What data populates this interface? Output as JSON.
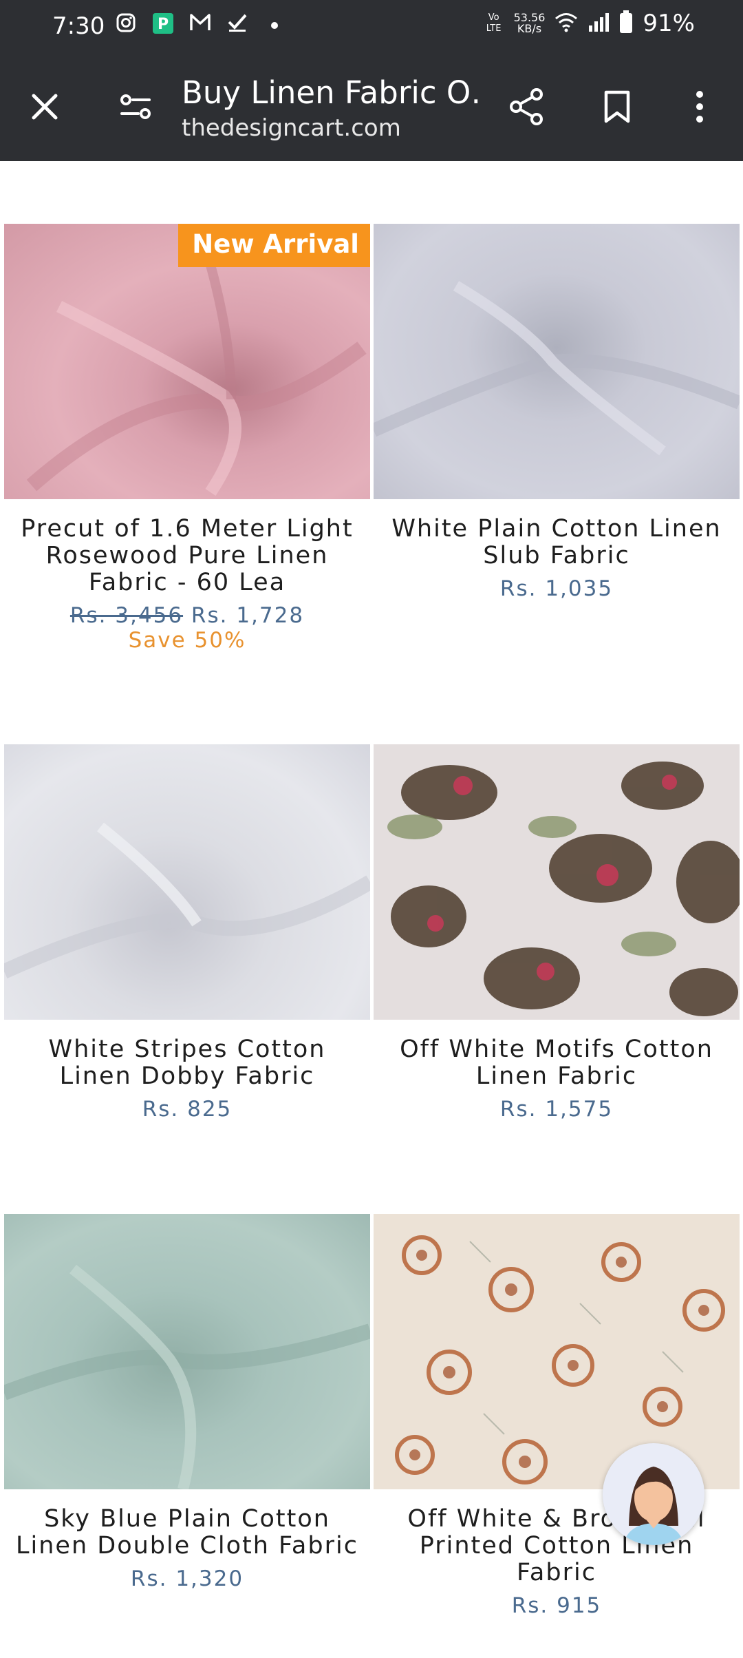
{
  "status_bar": {
    "time": "7:30",
    "net_speed_value": "53.56",
    "net_speed_unit": "KB/s",
    "volte": "Vo LTE",
    "battery": "91%",
    "icons": [
      "instagram-icon",
      "paytm-icon",
      "gmail-icon",
      "task-check-icon",
      "notification-dot-icon",
      "wifi-icon",
      "signal-icon",
      "battery-icon"
    ]
  },
  "toolbar": {
    "title": "Buy Linen Fabric O…",
    "url": "thedesigncart.com",
    "icons": [
      "close-icon",
      "site-settings-icon",
      "share-icon",
      "bookmark-icon",
      "more-vert-icon"
    ]
  },
  "products": [
    {
      "name": "Precut of 1.6 Meter Light Rosewood Pure Linen Fabric - 60 Lea",
      "old_price": "Rs. 3,456",
      "price": "Rs. 1,728",
      "save": "Save 50%",
      "badge": "New Arrival",
      "color": "#dca0ab"
    },
    {
      "name": "White Plain Cotton Linen Slub Fabric",
      "price": "Rs. 1,035",
      "color": "#c9cad6"
    },
    {
      "name": "White Stripes Cotton Linen Dobby Fabric",
      "price": "Rs. 825",
      "color": "#dcdde3"
    },
    {
      "name": "Off White Motifs Cotton Linen Fabric",
      "price": "Rs. 1,575",
      "color": "#e4dede"
    },
    {
      "name": "Sky Blue Plain Cotton Linen Double Cloth Fabric",
      "price": "Rs. 1,320",
      "color": "#a8c3bc"
    },
    {
      "name": "Off White & Brow… …l Printed Cotton Linen Fabric",
      "price": "Rs. 915",
      "color": "#ece2d6"
    }
  ],
  "colors": {
    "toolbar_bg": "#2d2f33",
    "price": "#4a6a8e",
    "save": "#e8922f",
    "badge": "#f7941d"
  }
}
